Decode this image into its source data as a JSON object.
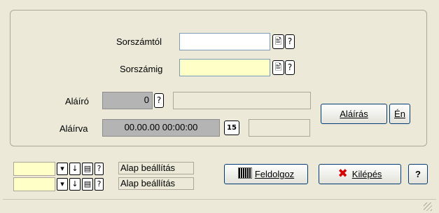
{
  "form": {
    "from_label": "Sorszámtól",
    "from_value": "",
    "to_label": "Sorszámig",
    "to_value": "",
    "signer_label": "Aláíró",
    "signer_value": "0",
    "signer_name": "",
    "signed_label": "Aláírva",
    "signed_value": "00.00.00 00:00:00",
    "signed_extra": "",
    "calendar_glyph": "15",
    "doc_glyph": "🖹",
    "help_glyph": "?"
  },
  "buttons": {
    "sign": "Aláírás",
    "me": "Én",
    "process": "Feldolgoz",
    "exit": "Kilépés",
    "help": "?"
  },
  "presets": [
    {
      "value": "",
      "label": "Alap beállítás"
    },
    {
      "value": "",
      "label": "Alap beállítás"
    }
  ],
  "colors": {
    "required_field": "#ffffc8",
    "readonly_field": "#b4b4b4",
    "exit_icon": "#d40000"
  }
}
